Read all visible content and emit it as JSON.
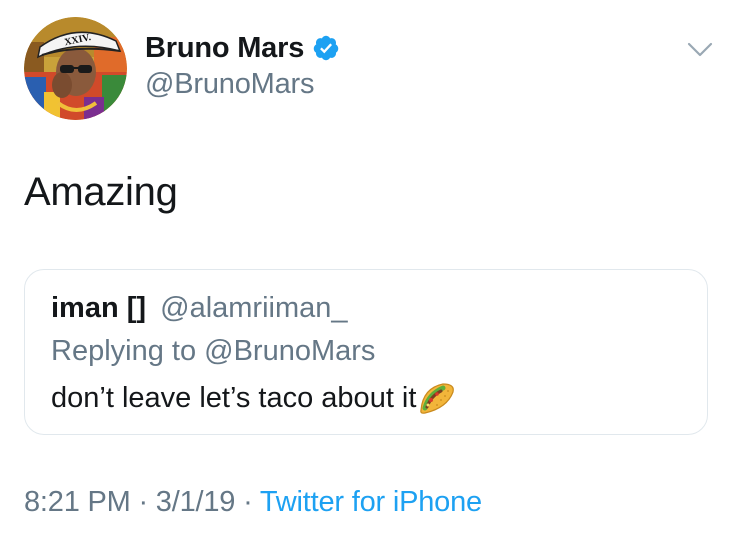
{
  "author": {
    "display_name": "Bruno Mars",
    "handle": "@BrunoMars",
    "verified": true,
    "avatar_hat_text": "XXIV."
  },
  "tweet": {
    "text": "Amazing"
  },
  "quoted_tweet": {
    "name": "iman",
    "name_symbol": "[]",
    "handle": "@alamriiman_",
    "replying_to": "Replying to @BrunoMars",
    "text": "don’t leave let’s taco about it",
    "emoji": "taco-icon"
  },
  "meta": {
    "time": "8:21 PM",
    "separator_1": " · ",
    "date": "3/1/19",
    "separator_2": " · ",
    "source": "Twitter for iPhone"
  },
  "colors": {
    "primary_text": "#14171a",
    "secondary_text": "#657786",
    "link": "#1da1f2",
    "border": "#e1e8ed",
    "verified_badge": "#1da1f2"
  },
  "icons": {
    "verified": "verified-badge-icon",
    "menu": "chevron-down-icon",
    "emoji": "taco-icon"
  }
}
